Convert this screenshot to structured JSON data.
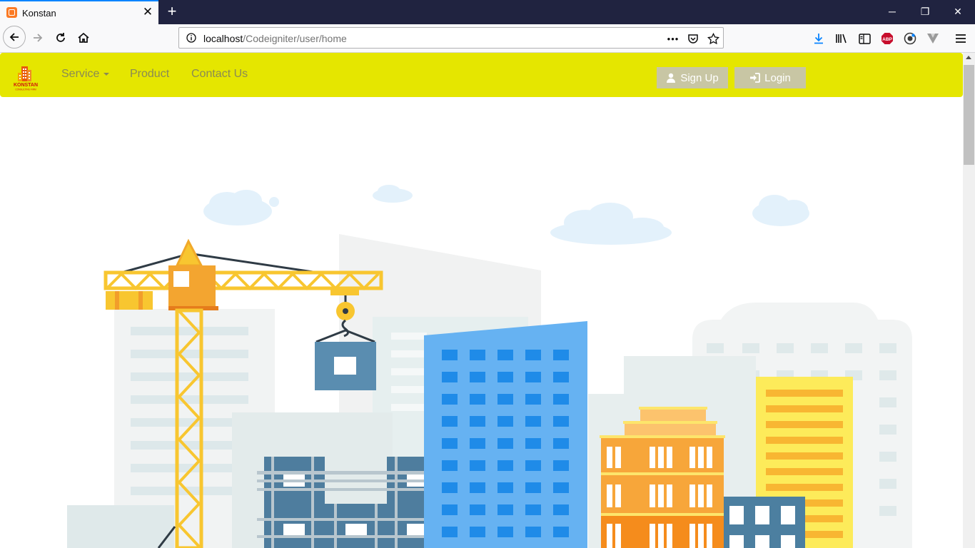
{
  "browser": {
    "tab": {
      "title": "Konstan",
      "close_glyph": "✕"
    },
    "new_tab_glyph": "+",
    "window_controls": {
      "minimize": "─",
      "maximize": "❐",
      "close": "✕"
    },
    "url": {
      "host": "localhost",
      "path": "/Codeigniter/user/home"
    },
    "page_actions_glyph": "•••",
    "toolbar_icons": [
      "download-icon",
      "library-icon",
      "sidebar-icon",
      "adblock-icon",
      "account-icon",
      "vpn-icon",
      "menu-icon"
    ],
    "adblock_label": "ABP"
  },
  "site": {
    "logo": {
      "name": "KONSTAN",
      "tagline": "CONSULTING FIRM"
    },
    "menu": {
      "service": "Service",
      "product": "Product",
      "contact": "Contact Us"
    },
    "buttons": {
      "signup": "Sign Up",
      "login": "Login"
    },
    "colors": {
      "header": "#e5e600",
      "menu_text": "#8a8a54",
      "button_bg": "#c8c6a4"
    }
  },
  "hero": {
    "illustration": "construction-city-illustration"
  }
}
